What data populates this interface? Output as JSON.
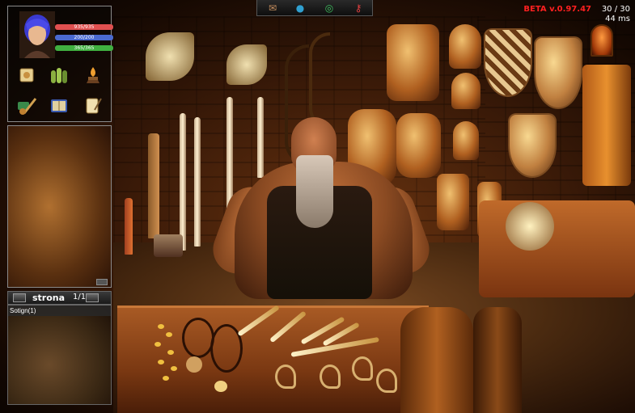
{
  "hud": {
    "hp": "935/935",
    "mana": "200/200",
    "stamina": "365/365",
    "hp_color": "#e05050",
    "mana_color": "#4a6ad0",
    "stamina_color": "#40b040"
  },
  "menu_icons": [
    {
      "name": "map-scroll-icon"
    },
    {
      "name": "party-icon"
    },
    {
      "name": "skills-icon"
    },
    {
      "name": "equipment-icon"
    },
    {
      "name": "spellbook-icon"
    },
    {
      "name": "quest-log-icon"
    }
  ],
  "pager": {
    "label": "strona",
    "page": "1/1"
  },
  "mail": {
    "entry": "Sotign(1)"
  },
  "toolbar": {
    "buttons": [
      {
        "name": "letter-icon",
        "glyph": "✉",
        "color": "#c89060"
      },
      {
        "name": "player-icon",
        "glyph": "●",
        "color": "#30a0d0"
      },
      {
        "name": "radar-icon",
        "glyph": "◎",
        "color": "#40c060"
      },
      {
        "name": "key-icon",
        "glyph": "⚷",
        "color": "#e04040"
      }
    ]
  },
  "status": {
    "version": "BETA v.0.97.47",
    "fps": "30 / 30",
    "ping": "44 ms"
  }
}
